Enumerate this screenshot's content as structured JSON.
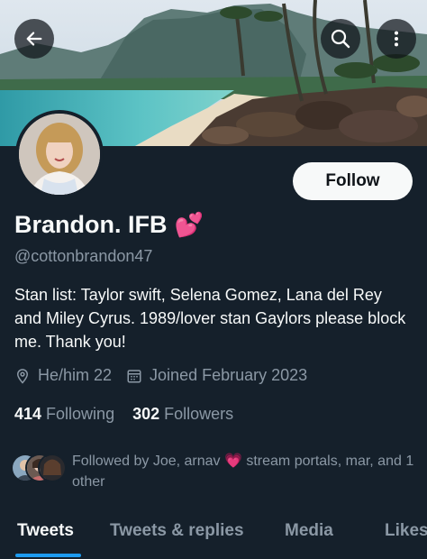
{
  "header": {
    "back_icon": "arrow-left-icon",
    "search_icon": "search-icon",
    "more_icon": "more-vertical-icon"
  },
  "profile": {
    "name": "Brandon. IFB",
    "name_emoji": "💕",
    "handle": "@cottonbrandon47",
    "bio": "Stan list: Taylor swift, Selena Gomez, Lana del Rey and Miley Cyrus. 1989/lover stan Gaylors please block me. Thank you!",
    "pronouns": "He/him 22",
    "joined": "Joined February 2023",
    "following_count": "414",
    "following_label": "Following",
    "followers_count": "302",
    "followers_label": "Followers",
    "followed_by_prefix": "Followed by Joe, arnav",
    "followed_by_emoji": "💗",
    "followed_by_suffix": "stream portals, mar, and 1 other"
  },
  "actions": {
    "follow_label": "Follow"
  },
  "tabs": [
    {
      "label": "Tweets",
      "active": true
    },
    {
      "label": "Tweets & replies",
      "active": false
    },
    {
      "label": "Media",
      "active": false
    },
    {
      "label": "Likes",
      "active": false
    }
  ],
  "colors": {
    "background": "#15202b",
    "text_primary": "#f7f9f9",
    "text_secondary": "#8b98a5",
    "accent": "#1d9bf0"
  }
}
